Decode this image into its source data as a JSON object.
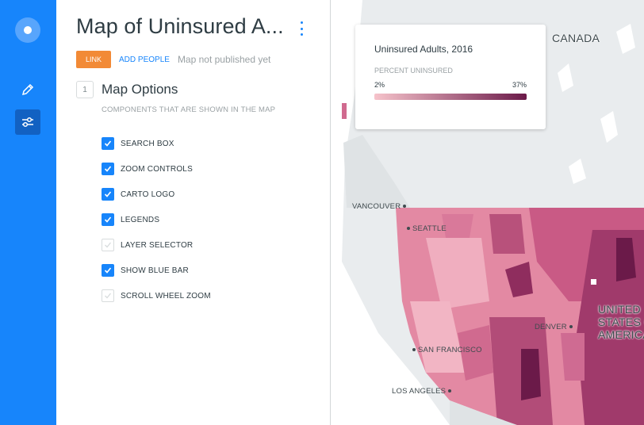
{
  "sidebar": {
    "icons": [
      "carto-logo-icon",
      "pencil-icon",
      "sliders-icon"
    ]
  },
  "panel": {
    "title": "Map of Uninsured A...",
    "link_label": "LINK",
    "add_people_label": "ADD PEOPLE",
    "publish_status": "Map not published yet",
    "step_number": "1",
    "section_title": "Map Options",
    "section_subtitle": "COMPONENTS THAT ARE SHOWN IN THE MAP",
    "options": [
      {
        "label": "SEARCH BOX",
        "checked": true
      },
      {
        "label": "ZOOM CONTROLS",
        "checked": true
      },
      {
        "label": "CARTO LOGO",
        "checked": true
      },
      {
        "label": "LEGENDS",
        "checked": true
      },
      {
        "label": "LAYER SELECTOR",
        "checked": false
      },
      {
        "label": "SHOW BLUE BAR",
        "checked": true
      },
      {
        "label": "SCROLL WHEEL ZOOM",
        "checked": false
      }
    ]
  },
  "legend": {
    "title": "Uninsured Adults, 2016",
    "subtitle": "PERCENT UNINSURED",
    "min": "2%",
    "max": "37%",
    "ramp_start": "#f6c3cb",
    "ramp_end": "#6b1a49"
  },
  "map": {
    "labels": {
      "canada": "CANADA",
      "usa_line1": "UNITED",
      "usa_line2": "STATES OF",
      "usa_line3": "AMERICA",
      "vancouver": "VANCOUVER",
      "seattle": "SEATTLE",
      "denver": "DENVER",
      "san_francisco": "SAN FRANCISCO",
      "los_angeles": "LOS ANGELES"
    },
    "colors": {
      "land": "#e9ecee",
      "water": "#ffffff",
      "accent": "#1785fb"
    }
  }
}
